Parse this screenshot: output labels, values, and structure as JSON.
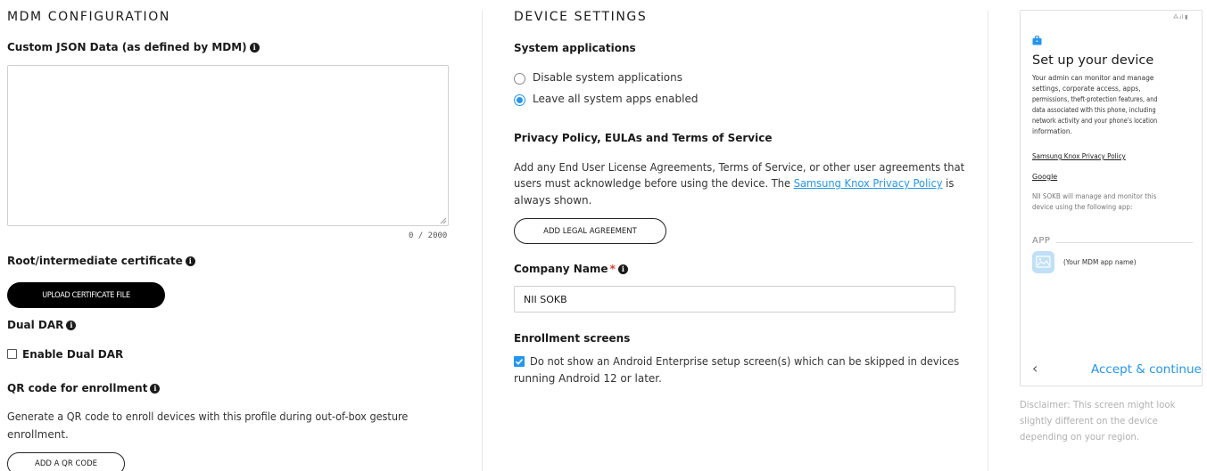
{
  "mdm": {
    "section_title": "MDM CONFIGURATION",
    "custom_json_label": "Custom JSON Data (as defined by MDM)",
    "custom_json_value": "",
    "char_counter": "0 / 2000",
    "root_cert_label": "Root/intermediate certificate",
    "upload_cert_button": "UPLOAD CERTIFICATE FILE",
    "dual_dar_label": "Dual DAR",
    "enable_dual_dar_label": "Enable Dual DAR",
    "enable_dual_dar_checked": false,
    "qr_label": "QR code for enrollment",
    "qr_desc_line1": "Generate a QR code to enroll devices with this profile during out-of-box gesture",
    "qr_desc_line2": "enrollment.",
    "add_qr_button": "ADD A QR CODE"
  },
  "device": {
    "section_title": "DEVICE SETTINGS",
    "system_apps_label": "System applications",
    "system_apps_options": [
      {
        "label": "Disable system applications",
        "selected": false
      },
      {
        "label": "Leave all system apps enabled",
        "selected": true
      }
    ],
    "privacy_label": "Privacy Policy, EULAs and Terms of Service",
    "privacy_desc_line1": "Add any End User License Agreements, Terms of Service, or other user agreements that",
    "privacy_desc_line2_pre": "users must acknowledge before using the device. The ",
    "privacy_desc_link": "Samsung Knox Privacy Policy",
    "privacy_desc_line2_post": " is",
    "privacy_desc_line3": "always shown.",
    "add_legal_button": "ADD LEGAL AGREEMENT",
    "company_name_label": "Company Name",
    "required_mark": "*",
    "company_name_value": "NII SOKB",
    "enrollment_label": "Enrollment screens",
    "enrollment_option_line1": "Do not show an Android Enterprise setup screen(s) which can be skipped in devices",
    "enrollment_option_line2": "running Android 12 or later.",
    "enrollment_option_checked": true
  },
  "preview": {
    "status_bar": "⁂.ıl ▮",
    "title": "Set up your device",
    "desc_lines": [
      "Your admin can monitor and manage",
      "settings, corporate access, apps,",
      "permissions, theft-protection features, and",
      "data associated with this phone, including",
      "network activity and your phone's location",
      "information."
    ],
    "link_knox": "Samsung Knox Privacy Policy",
    "link_google": "Google",
    "manage_line1": "NII SOKB will manage and monitor this",
    "manage_line2": "device using the following app:",
    "app_header": "APP",
    "app_name": "(Your MDM app name)",
    "back_glyph": "‹",
    "accept_button": "Accept & continue",
    "disclaimer_lines": [
      "Disclaimer: This screen might look",
      "slightly different on the device",
      "depending on your region."
    ],
    "accent": "#2196f3"
  }
}
